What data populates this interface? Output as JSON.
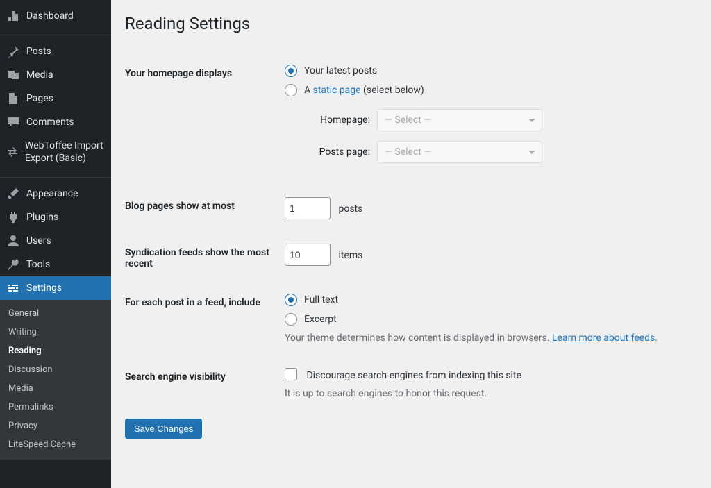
{
  "sidebar": {
    "items": [
      {
        "icon": "dashboard",
        "label": "Dashboard"
      },
      {
        "icon": "pin",
        "label": "Posts"
      },
      {
        "icon": "media",
        "label": "Media"
      },
      {
        "icon": "page",
        "label": "Pages"
      },
      {
        "icon": "comment",
        "label": "Comments"
      },
      {
        "icon": "migrate",
        "label": "WebToffee Import Export (Basic)"
      },
      {
        "icon": "brush",
        "label": "Appearance"
      },
      {
        "icon": "plugin",
        "label": "Plugins"
      },
      {
        "icon": "user",
        "label": "Users"
      },
      {
        "icon": "tool",
        "label": "Tools"
      },
      {
        "icon": "settings",
        "label": "Settings"
      }
    ],
    "current_index": 10,
    "submenu": [
      "General",
      "Writing",
      "Reading",
      "Discussion",
      "Media",
      "Permalinks",
      "Privacy",
      "LiteSpeed Cache"
    ],
    "submenu_current_index": 2
  },
  "page": {
    "title": "Reading Settings",
    "rows": {
      "homepage": {
        "label": "Your homepage displays",
        "opt1": "Your latest posts",
        "opt2_pre": "A ",
        "opt2_link": "static page",
        "opt2_post": " (select below)",
        "homepage_label": "Homepage:",
        "postspage_label": "Posts page:",
        "select_placeholder": "— Select —"
      },
      "blogpages": {
        "label": "Blog pages show at most",
        "value": "1",
        "unit": "posts"
      },
      "feeds": {
        "label": "Syndication feeds show the most recent",
        "value": "10",
        "unit": "items"
      },
      "feedcontent": {
        "label": "For each post in a feed, include",
        "opt1": "Full text",
        "opt2": "Excerpt",
        "note_pre": "Your theme determines how content is displayed in browsers. ",
        "note_link": "Learn more about feeds"
      },
      "visibility": {
        "label": "Search engine visibility",
        "checkbox": "Discourage search engines from indexing this site",
        "note": "It is up to search engines to honor this request."
      }
    },
    "save": "Save Changes"
  }
}
